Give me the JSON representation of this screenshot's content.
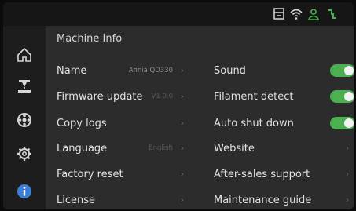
{
  "section_title": "Machine Info",
  "left_rows": [
    {
      "label": "Name",
      "value": "Afinia QD330",
      "chevron": "›"
    },
    {
      "label": "Firmware update",
      "value": "V1.0.0",
      "chevron": "›"
    },
    {
      "label": "Copy logs",
      "value": "",
      "chevron": "›"
    },
    {
      "label": "Language",
      "value": "English",
      "chevron": "›"
    },
    {
      "label": "Factory reset",
      "value": "",
      "chevron": "›"
    },
    {
      "label": "License",
      "value": "",
      "chevron": "›"
    }
  ],
  "right_rows": [
    {
      "label": "Sound",
      "toggle": true
    },
    {
      "label": "Filament detect",
      "toggle": true
    },
    {
      "label": "Auto shut down",
      "toggle": true
    },
    {
      "label": "Website",
      "chevron": "›"
    },
    {
      "label": "After-sales support",
      "chevron": "›"
    },
    {
      "label": "Maintenance guide",
      "chevron": "›"
    }
  ],
  "status_icons": [
    "printer-icon",
    "wifi-icon",
    "person-icon",
    "filament-icon"
  ],
  "sidebar_icons": [
    "home-icon",
    "print-bed-icon",
    "filament-spool-icon",
    "gear-icon",
    "info-icon"
  ],
  "colors": {
    "accent_green": "#4caf50",
    "info_blue": "#3b7fd9",
    "status_green": "#4caf50",
    "background": "#2c2c2c"
  }
}
